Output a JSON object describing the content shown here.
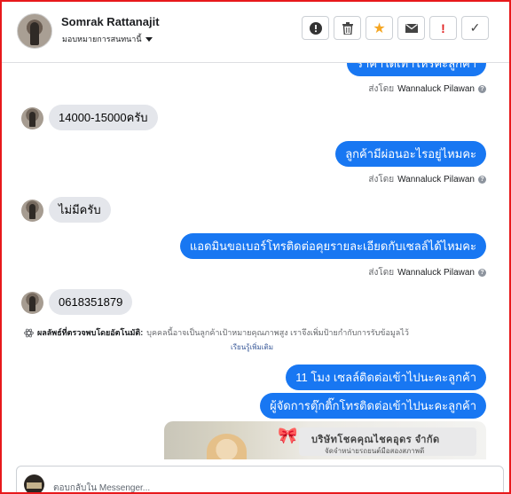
{
  "header": {
    "contact_name": "Somrak Rattanajit",
    "assign_label": "มอบหมายการสนทนานี้",
    "actions": [
      {
        "name": "info-icon",
        "symbol": "!"
      },
      {
        "name": "trash-icon",
        "symbol": ""
      },
      {
        "name": "star-icon",
        "symbol": "★"
      },
      {
        "name": "mail-icon",
        "symbol": "✉"
      },
      {
        "name": "spam-icon",
        "symbol": "!"
      },
      {
        "name": "check-icon",
        "symbol": "✓"
      }
    ],
    "colors": {
      "star": "#f5a623",
      "spam": "#e02020"
    }
  },
  "messages": [
    {
      "type": "out",
      "text": "ราคาใดเท่าไหร่คะลูกค้า",
      "sent_by_prefix": "ส่งโดย",
      "sent_by": "Wannaluck Pilawan"
    },
    {
      "type": "in",
      "text": "14000-15000ครับ"
    },
    {
      "type": "out",
      "text": "ลูกค้ามีผ่อนอะไรอยู่ไหมคะ",
      "sent_by_prefix": "ส่งโดย",
      "sent_by": "Wannaluck Pilawan"
    },
    {
      "type": "in",
      "text": "ไม่มีครับ"
    },
    {
      "type": "out",
      "text": "แอดมินขอเบอร์โทรติดต่อคุยรายละเอียดกับเซลล์ได้ไหมคะ",
      "sent_by_prefix": "ส่งโดย",
      "sent_by": "Wannaluck Pilawan"
    },
    {
      "type": "in",
      "text": "0618351879"
    },
    {
      "type": "out",
      "text": "11 โมง เซลล์ติดต่อเข้าไปนะคะลูกค้า"
    },
    {
      "type": "out",
      "text": "ผู้จัดการตุ๊กติ๊กโทรติดต่อเข้าไปนะคะลูกค้า"
    }
  ],
  "auto_detect": {
    "label": "ผลลัพธ์ที่ตรวจพบโดยอัตโนมัติ:",
    "text": "บุคคลนี้อาจเป็นลูกค้าเป้าหมายคุณภาพสูง เราจึงเพิ่มป้ายกำกับการรับข้อมูลไว้",
    "learn_more": "เรียนรู้เพิ่มเติม"
  },
  "image_card": {
    "company": "บริษัทโชคคุณไชคอุดร จำกัด",
    "tagline": "จัดจำหน่ายรถยนต์มือสองสภาพดี"
  },
  "reply": {
    "placeholder": "ตอบกลับใน Messenger..."
  }
}
